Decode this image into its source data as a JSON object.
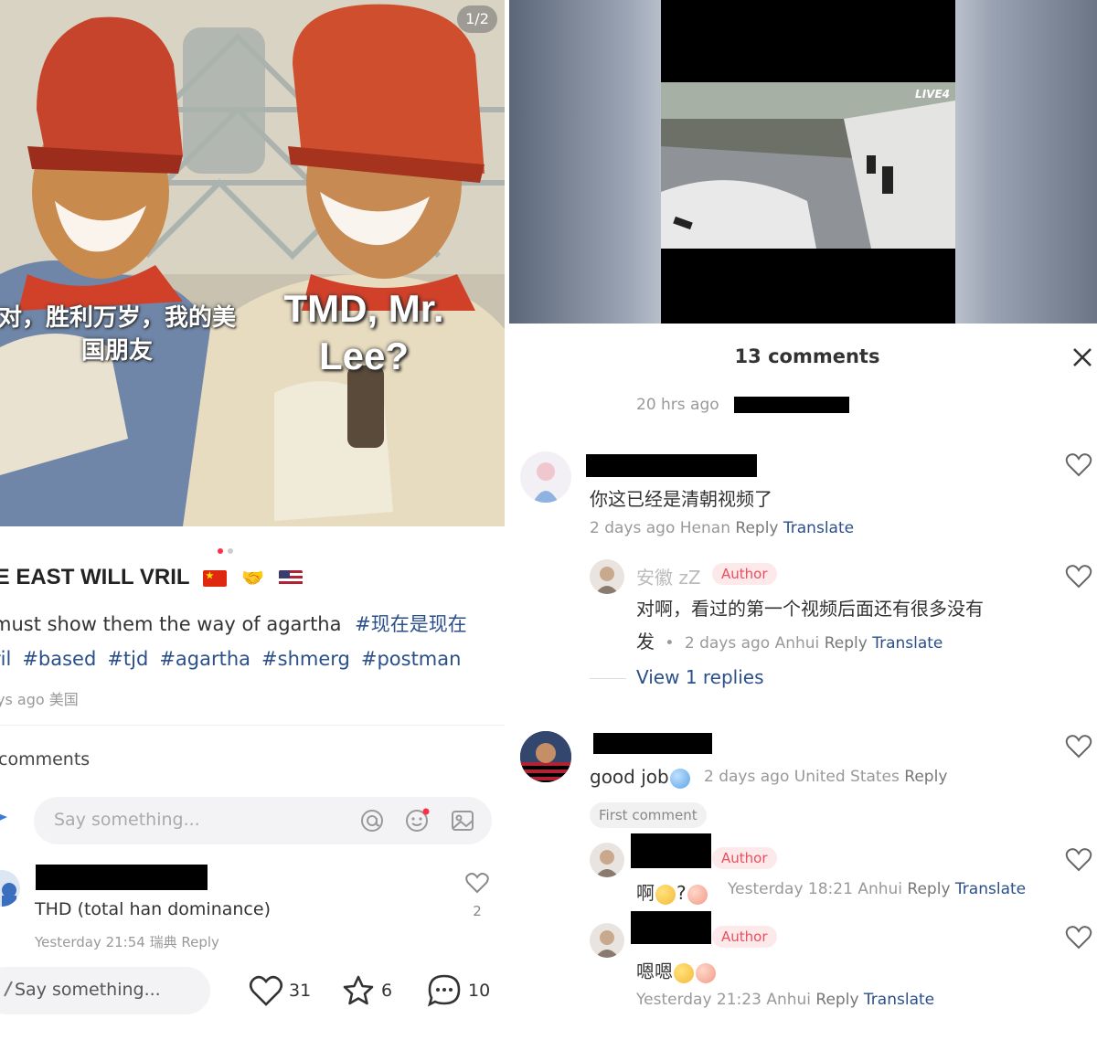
{
  "left": {
    "image_counter": "1/2",
    "caption_cn": "对，胜利万岁，我的美国朋友",
    "caption_en": "TMD, Mr. Lee?",
    "post_title": "IE EAST WILL VRIL",
    "post_text": "must show them the way of agartha",
    "hashtags": [
      "#现在是现在",
      "ril",
      "#based",
      "#tjd",
      "#agartha",
      "#shmerg",
      "#postman"
    ],
    "post_time": "ys ago 美国",
    "comment_count": "comments",
    "say_placeholder": "Say something...",
    "comment": {
      "text": "THD (total han dominance)",
      "meta": "Yesterday 21:54 瑞典 Reply",
      "likes": "2"
    },
    "bottom": {
      "say": "Say something...",
      "likes": "31",
      "stars": "6",
      "comments": "10"
    }
  },
  "right": {
    "video_label": "LIVE4",
    "title": "13 comments",
    "post_time": "20 hrs ago",
    "comments": [
      {
        "text": "你这已经是清朝视频了",
        "meta_time": "2 days ago Henan",
        "reply": "Reply",
        "translate": "Translate"
      },
      {
        "username": "安徽 zZ",
        "author_tag": "Author",
        "text_line1": "对啊，看过的第一个视频后面还有很多没有",
        "text_line2": "发",
        "meta_time": "2 days ago Anhui",
        "reply": "Reply",
        "translate": "Translate"
      },
      {
        "text": "good job",
        "meta_time": "2 days ago United States",
        "reply": "Reply",
        "badge": "First comment"
      },
      {
        "author_tag": "Author",
        "text": "啊",
        "text_suffix": "?",
        "meta_time": "Yesterday 18:21 Anhui",
        "reply": "Reply",
        "translate": "Translate"
      },
      {
        "author_tag": "Author",
        "text": "嗯嗯",
        "meta_time": "Yesterday 21:23 Anhui",
        "reply": "Reply",
        "translate": "Translate"
      }
    ],
    "view_replies": "View 1 replies"
  },
  "colors": {
    "accent_red": "#ff2d4b",
    "link_blue": "#2a4f8a",
    "author_pink": "#e8505f"
  }
}
